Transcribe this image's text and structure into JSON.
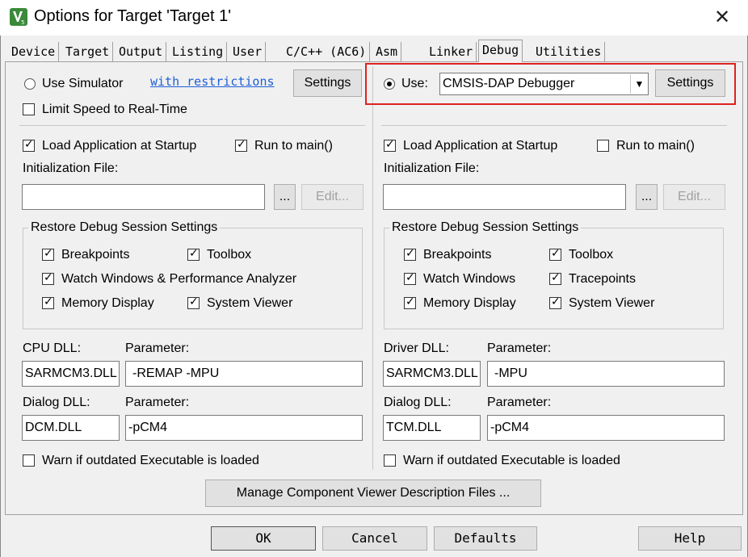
{
  "window": {
    "title": "Options for Target 'Target 1'",
    "close_glyph": "✕"
  },
  "tabs": [
    "Device",
    "Target",
    "Output",
    "Listing",
    "User",
    "C/C++ (AC6)",
    "Asm",
    "Linker",
    "Debug",
    "Utilities"
  ],
  "active_tab": "Debug",
  "left": {
    "use_simulator_label": "Use Simulator",
    "restrictions_link": "with restrictions",
    "settings_label": "Settings",
    "limit_speed_label": "Limit Speed to Real-Time",
    "load_app_label": "Load Application at Startup",
    "run_to_main_label": "Run to main()",
    "init_file_label": "Initialization File:",
    "init_file_value": "",
    "browse_label": "...",
    "edit_label": "Edit...",
    "restore_title": "Restore Debug Session Settings",
    "breakpoints_label": "Breakpoints",
    "toolbox_label": "Toolbox",
    "watch_label": "Watch Windows & Performance Analyzer",
    "memory_label": "Memory Display",
    "sysviewer_label": "System Viewer",
    "cpu_dll_label": "CPU DLL:",
    "param_label": "Parameter:",
    "cpu_dll_value": "SARMCM3.DLL",
    "cpu_param_value": "-REMAP -MPU",
    "dialog_dll_label": "Dialog DLL:",
    "dialog_dll_value": "DCM.DLL",
    "dialog_param_value": "-pCM4",
    "warn_label": "Warn if outdated Executable is loaded"
  },
  "right": {
    "use_label": "Use:",
    "debugger_selected": "CMSIS-DAP Debugger",
    "settings_label": "Settings",
    "load_app_label": "Load Application at Startup",
    "run_to_main_label": "Run to main()",
    "init_file_label": "Initialization File:",
    "init_file_value": "",
    "browse_label": "...",
    "edit_label": "Edit...",
    "restore_title": "Restore Debug Session Settings",
    "breakpoints_label": "Breakpoints",
    "toolbox_label": "Toolbox",
    "watch_label": "Watch Windows",
    "tracepoints_label": "Tracepoints",
    "memory_label": "Memory Display",
    "sysviewer_label": "System Viewer",
    "driver_dll_label": "Driver DLL:",
    "param_label": "Parameter:",
    "driver_dll_value": "SARMCM3.DLL",
    "driver_param_value": "-MPU",
    "dialog_dll_label": "Dialog DLL:",
    "dialog_dll_value": "TCM.DLL",
    "dialog_param_value": "-pCM4",
    "warn_label": "Warn if outdated Executable is loaded"
  },
  "manage_button": "Manage Component Viewer Description Files ...",
  "footer": {
    "ok": "OK",
    "cancel": "Cancel",
    "defaults": "Defaults",
    "help": "Help"
  },
  "colors": {
    "highlight": "#e02020",
    "link": "#1e5fd8",
    "icon_green": "#3a8a3a"
  }
}
